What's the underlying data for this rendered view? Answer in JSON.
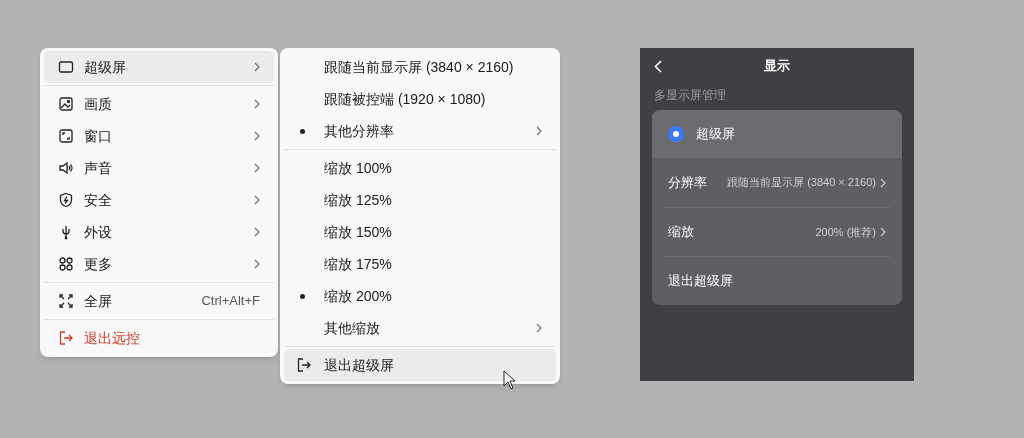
{
  "main_menu": {
    "groups": [
      [
        {
          "label": "超级屏",
          "highlighted": true,
          "submenu": true,
          "danger": false
        }
      ],
      [
        {
          "label": "画质",
          "highlighted": false,
          "submenu": true,
          "danger": false
        },
        {
          "label": "窗口",
          "highlighted": false,
          "submenu": true,
          "danger": false
        },
        {
          "label": "声音",
          "highlighted": false,
          "submenu": true,
          "danger": false
        },
        {
          "label": "安全",
          "highlighted": false,
          "submenu": true,
          "danger": false
        },
        {
          "label": "外设",
          "highlighted": false,
          "submenu": true,
          "danger": false
        },
        {
          "label": "更多",
          "highlighted": false,
          "submenu": true,
          "danger": false
        }
      ],
      [
        {
          "label": "全屏",
          "shortcut": "Ctrl+Alt+F",
          "highlighted": false,
          "submenu": false,
          "danger": false
        }
      ],
      [
        {
          "label": "退出远控",
          "highlighted": false,
          "submenu": false,
          "danger": true
        }
      ]
    ]
  },
  "sub_menu": {
    "groups": [
      [
        {
          "label": "跟随当前显示屏 (3840 × 2160)",
          "selected": false,
          "submenu": false,
          "highlighted": false
        },
        {
          "label": "跟随被控端 (1920 × 1080)",
          "selected": false,
          "submenu": false,
          "highlighted": false
        },
        {
          "label": "其他分辨率",
          "selected": true,
          "submenu": true,
          "highlighted": false
        }
      ],
      [
        {
          "label": "缩放 100%",
          "selected": false,
          "submenu": false,
          "highlighted": false
        },
        {
          "label": "缩放 125%",
          "selected": false,
          "submenu": false,
          "highlighted": false
        },
        {
          "label": "缩放 150%",
          "selected": false,
          "submenu": false,
          "highlighted": false
        },
        {
          "label": "缩放 175%",
          "selected": false,
          "submenu": false,
          "highlighted": false
        },
        {
          "label": "缩放 200%",
          "selected": true,
          "submenu": false,
          "highlighted": false
        },
        {
          "label": "其他缩放",
          "selected": false,
          "submenu": true,
          "highlighted": false
        }
      ],
      [
        {
          "label": "退出超级屏",
          "selected": false,
          "submenu": false,
          "highlighted": true,
          "kind": "exit"
        }
      ]
    ]
  },
  "phone": {
    "title": "显示",
    "section_label": "多显示屏管理",
    "radio": {
      "label": "超级屏",
      "selected": true
    },
    "rows": [
      {
        "label": "分辨率",
        "value": "跟随当前显示屏 (3840 × 2160)"
      },
      {
        "label": "缩放",
        "value": "200% (推荐)"
      },
      {
        "label": "退出超级屏"
      }
    ]
  }
}
